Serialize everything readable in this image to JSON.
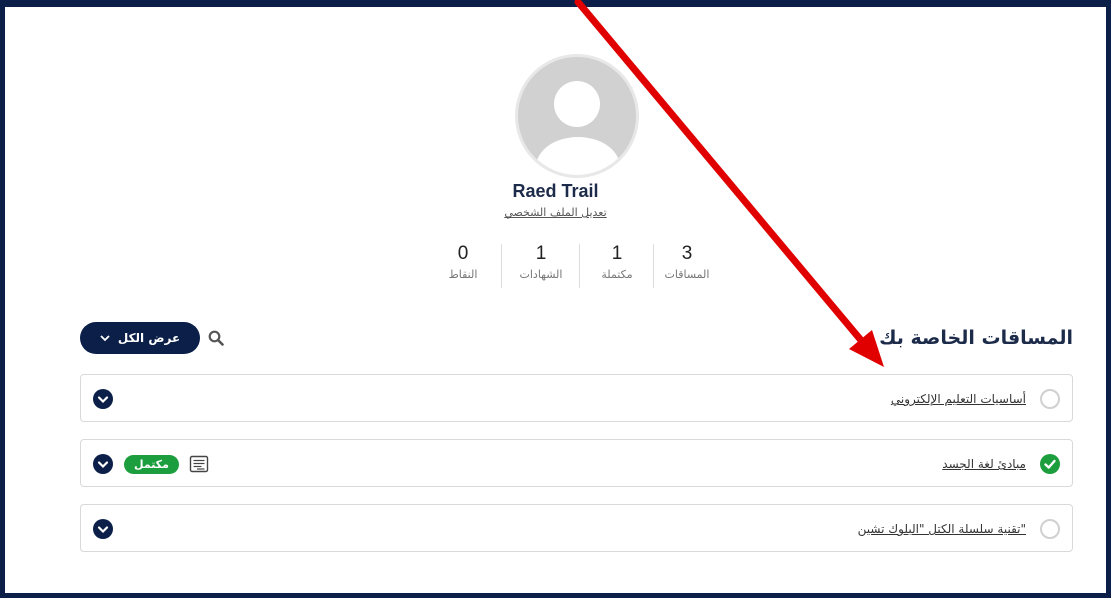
{
  "profile": {
    "name": "Raed Trail",
    "edit_link": "تعديل الملف الشخصي",
    "avatar_icon": "default-user-avatar-icon"
  },
  "stats": [
    {
      "value": "3",
      "label": "المساقات"
    },
    {
      "value": "1",
      "label": "مكتملة"
    },
    {
      "value": "1",
      "label": "الشهادات"
    },
    {
      "value": "0",
      "label": "النقاط"
    }
  ],
  "courses_section": {
    "title": "المساقات الخاصة بك",
    "show_all": "عرض الكل",
    "search_icon": "search-icon"
  },
  "courses": [
    {
      "title": "أساسيات التعليم الإلكتروني",
      "completed": false
    },
    {
      "title": "مبادئ لغة الجسد",
      "completed": true,
      "badge": "مكتمل",
      "certificate_icon": "certificate-icon"
    },
    {
      "title": "\"تقنية سلسلة الكتل \"البلوك تشين",
      "completed": false
    }
  ],
  "colors": {
    "primary": "#0b1f49",
    "success": "#1d9e3e",
    "annotation_arrow": "#e00000"
  }
}
